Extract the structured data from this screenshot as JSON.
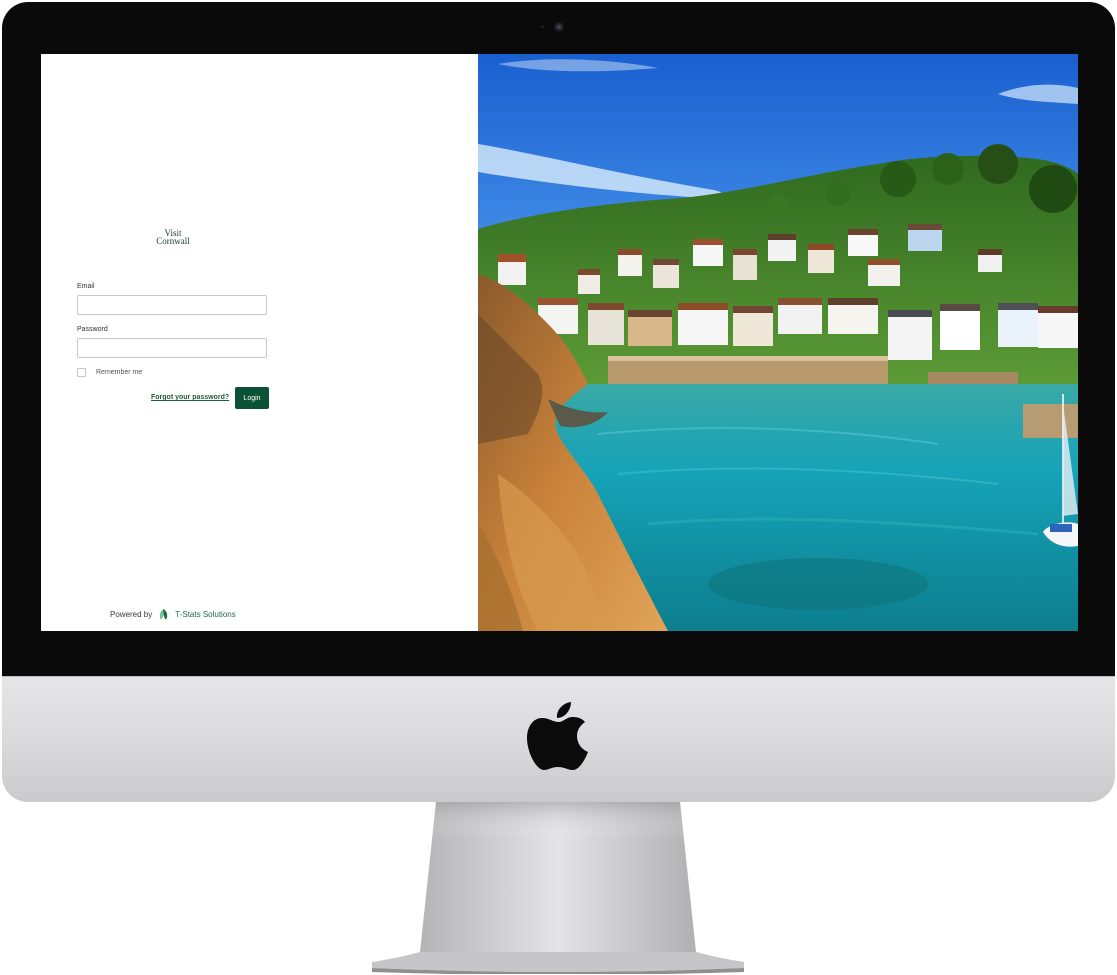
{
  "device": {
    "logo_icon": "apple-logo-icon",
    "camera_icon": "webcam-icon"
  },
  "login_page": {
    "brand": {
      "line1": "Visit",
      "line2": "Cornwall"
    },
    "email": {
      "label": "Email",
      "value": "",
      "placeholder": ""
    },
    "password": {
      "label": "Password",
      "value": "",
      "placeholder": ""
    },
    "remember": {
      "label": "Remember me",
      "checked": false
    },
    "forgot_link": "Forgot your password?",
    "login_button": "Login",
    "footer": {
      "powered_by": "Powered by",
      "company": "T-Stats Solutions",
      "company_icon": "leaf-icon"
    },
    "colors": {
      "accent": "#0b5135",
      "link": "#1e5c3c"
    }
  },
  "hero_image": {
    "subject": "coastal-harbour-village-photo",
    "colors": {
      "sky": "#2a6ed8",
      "sea": "#1fa9b0",
      "cliff": "#c9823a",
      "hill": "#3f7d2a"
    }
  }
}
